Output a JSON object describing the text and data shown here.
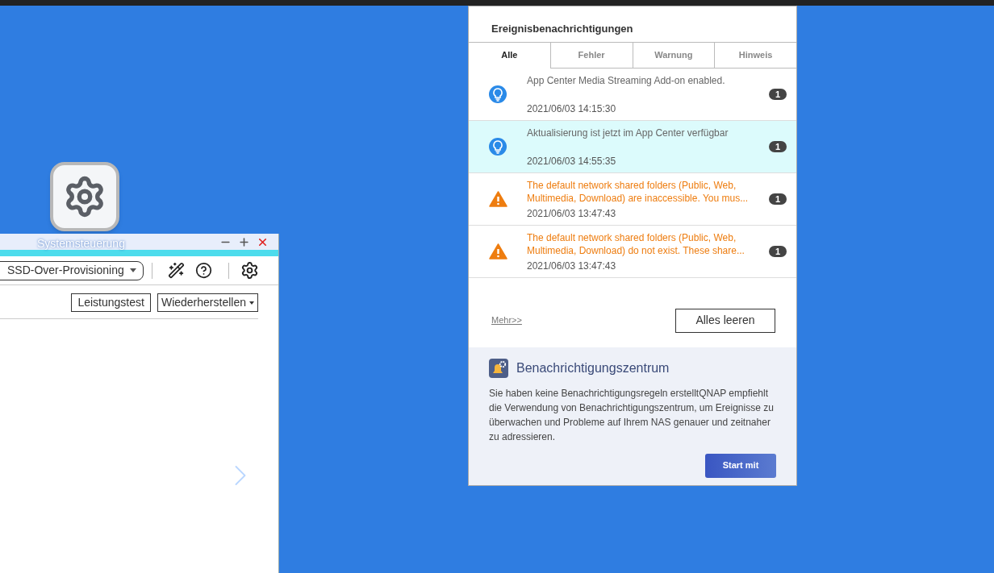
{
  "desktop_icon": {
    "label": "Systemsteuerung"
  },
  "window": {
    "toolbar": {
      "dropdown": "SSD-Over-Provisioning"
    },
    "buttons": [
      "Leistungstest",
      "Wiederherstellen"
    ]
  },
  "notifications": {
    "title": "Ereignisbenachrichtigungen",
    "tabs": [
      {
        "label": "Alle",
        "selected": true
      },
      {
        "label": "Fehler",
        "selected": false
      },
      {
        "label": "Warnung",
        "selected": false
      },
      {
        "label": "Hinweis",
        "selected": false
      }
    ],
    "items": [
      {
        "kind": "info",
        "message": "App Center Media Streaming Add-on enabled.",
        "time": "2021/06/03 14:15:30",
        "count": "1",
        "selected": false
      },
      {
        "kind": "info",
        "message": "Aktualisierung ist jetzt im App Center verfügbar",
        "time": "2021/06/03 14:55:35",
        "count": "1",
        "selected": true
      },
      {
        "kind": "warning",
        "message": "The default network shared folders (Public, Web, Multimedia, Download) are inaccessible. You mus...",
        "time": "2021/06/03 13:47:43",
        "count": "1",
        "selected": false
      },
      {
        "kind": "warning",
        "message": "The default network shared folders (Public, Web, Multimedia, Download) do not exist. These share...",
        "time": "2021/06/03 13:47:43",
        "count": "1",
        "selected": false
      }
    ],
    "more_link": "Mehr>>",
    "clear_button": "Alles leeren"
  },
  "notification_center": {
    "title": "Benachrichtigungszentrum",
    "description": "Sie haben keine Benachrichtigungsregeln erstelltQNAP empfiehlt die Verwendung von Benachrichtigungszentrum, um Ereignisse zu überwachen und Probleme auf Ihrem NAS genauer und zeitnaher zu adressieren.",
    "button": "Start mit"
  }
}
